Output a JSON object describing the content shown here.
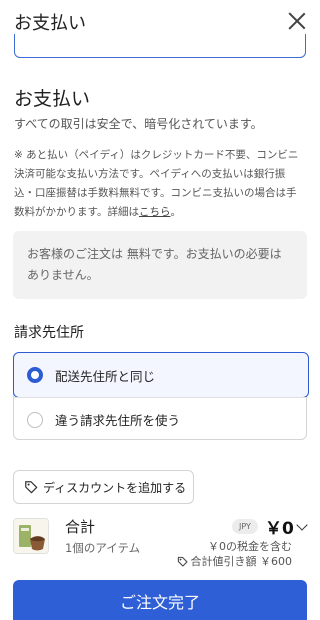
{
  "header": {
    "title": "お支払い"
  },
  "payment": {
    "title": "お支払い",
    "subtitle": "すべての取引は安全で、暗号化されています。",
    "note_text": "※ あと払い（ペイディ）はクレジットカード不要、コンビニ決済可能な支払い方法です。ペイディへの支払いは銀行振込・口座振替は手数料無料です。コンビニ支払いの場合は手数料がかかります。詳細は",
    "note_link": "こちら",
    "note_end": "。",
    "free_message": "お客様のご注文は 無料です。お支払いの必要はありません。"
  },
  "billing": {
    "title": "請求先住所",
    "options": [
      {
        "label": "配送先住所と同じ",
        "selected": true
      },
      {
        "label": "違う請求先住所を使う",
        "selected": false
      }
    ]
  },
  "discount": {
    "button_label": "ディスカウントを追加する"
  },
  "summary": {
    "total_label": "合計",
    "items_count": "1個のアイテム",
    "currency": "JPY",
    "total_amount": "￥0",
    "tax_note": "￥0の税金を含む",
    "discount_total": "合計値引き額 ￥600"
  },
  "submit": {
    "label": "ご注文完了"
  },
  "colors": {
    "accent": "#2f5fd6",
    "selected_bg": "#f3f6fe",
    "box_bg": "#f2f2f2"
  }
}
